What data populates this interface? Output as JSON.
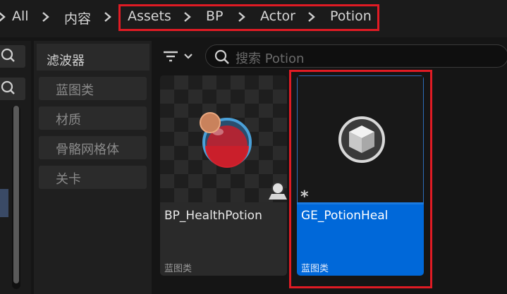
{
  "breadcrumb": {
    "items": [
      "All",
      "内容",
      "Assets",
      "BP",
      "Actor",
      "Potion"
    ]
  },
  "filters": {
    "title": "滤波器",
    "items": [
      "蓝图类",
      "材质",
      "骨骼网格体",
      "关卡"
    ]
  },
  "search": {
    "placeholder": "搜索 Potion"
  },
  "assets": [
    {
      "name": "BP_HealthPotion",
      "type": "蓝图类",
      "selected": false
    },
    {
      "name": "GE_PotionHeal",
      "type": "蓝图类",
      "selected": true
    }
  ],
  "colors": {
    "selection_blue": "#0068d9",
    "highlight_red": "#e01b24"
  }
}
